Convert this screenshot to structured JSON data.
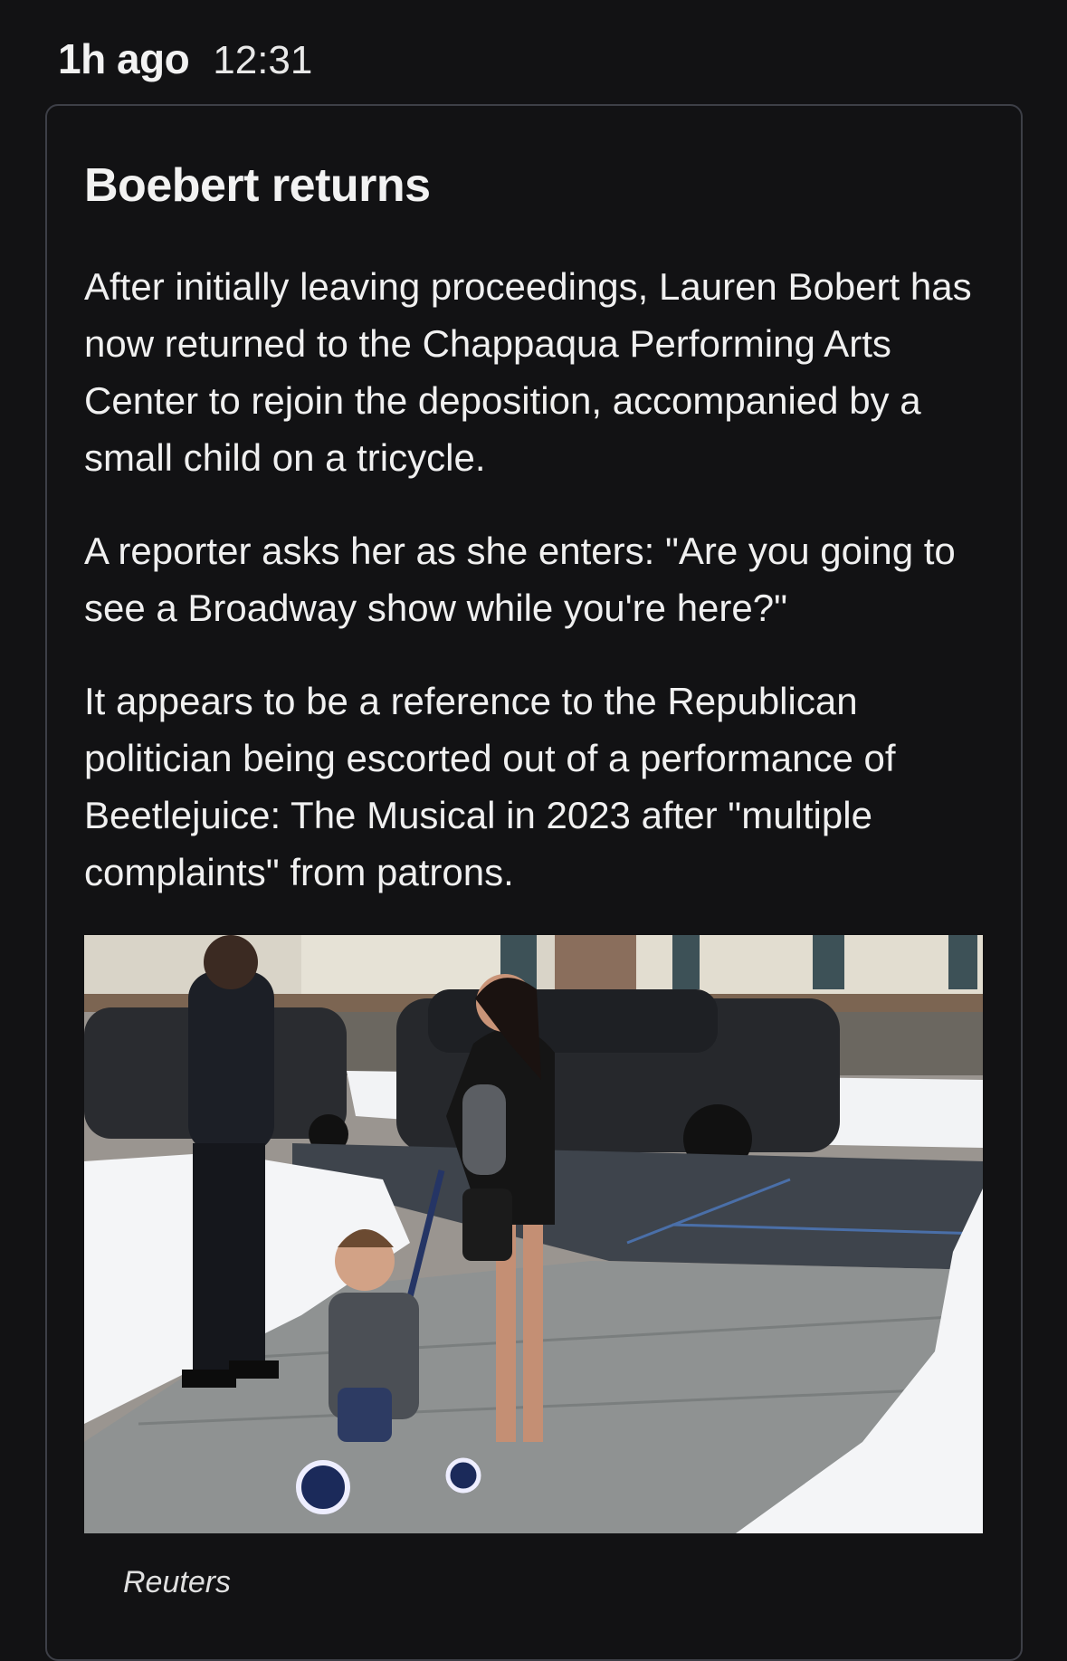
{
  "header": {
    "relative_time": "1h ago",
    "time": "12:31"
  },
  "post": {
    "title": "Boebert returns",
    "paragraphs": [
      "After initially leaving proceedings, Lauren Bobert has now returned to the Chappaqua Performing Arts Center to rejoin the deposition, accompanied by a small child on a tricycle.",
      "A reporter asks her as she enters: \"Are you going to see a Broadway show while you're here?\"",
      "It appears to be a reference to the Republican politician being escorted out of a performance of Beetlejuice: The Musical in 2023 after \"multiple complaints\" from patrons."
    ],
    "image_caption": "Reuters"
  },
  "colors": {
    "background": "#121214",
    "card_border": "#3d3f47",
    "text": "#f2f2f2"
  }
}
